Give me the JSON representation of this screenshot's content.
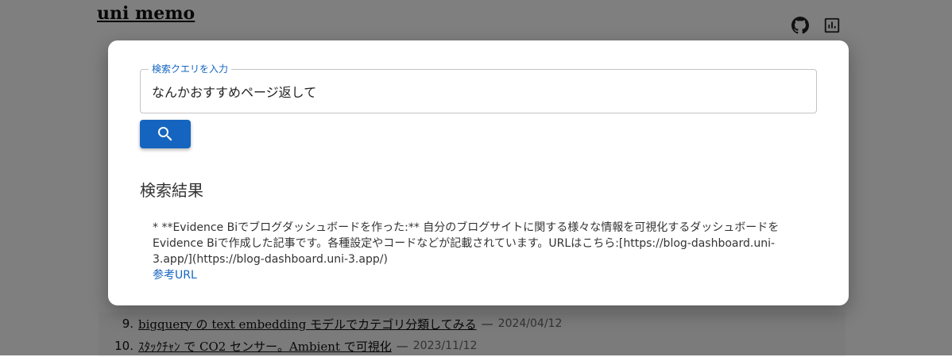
{
  "site": {
    "title": "uni memo"
  },
  "posts": [
    {
      "num": "9.",
      "title": "bigquery の text embedding モデルでカテゴリ分類してみる",
      "date": "2024/04/12"
    },
    {
      "num": "10.",
      "title": "ｽﾀｯｸﾁｬﾝ で CO2 センサー。Ambient で可視化",
      "date": "2023/11/12"
    }
  ],
  "post_separator": "—",
  "search": {
    "label": "検索クエリを入力",
    "value": "なんかおすすめページ返して"
  },
  "results": {
    "heading": "検索結果",
    "text": "* **Evidence Biでブログダッシュボードを作った:** 自分のブログサイトに関する様々な情報を可視化するダッシュボードをEvidence Biで作成した記事です。各種設定やコードなどが記載されています。URLはこちら:[https://blog-dashboard.uni-3.app/](https://blog-dashboard.uni-3.app/)",
    "link_label": "参考URL"
  },
  "icons": {
    "header": [
      "github-icon",
      "dashboard-icon"
    ],
    "search_button": "search-icon"
  },
  "colors": {
    "accent": "#1565c0"
  }
}
